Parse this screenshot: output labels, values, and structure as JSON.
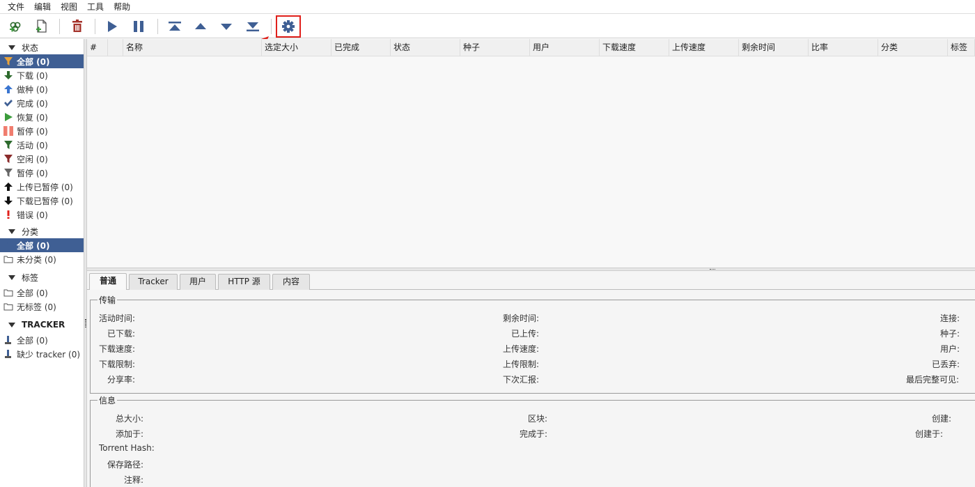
{
  "menu": [
    "文件",
    "编辑",
    "视图",
    "工具",
    "帮助"
  ],
  "toolbar": {
    "buttons": [
      {
        "name": "add-torrent-link-icon"
      },
      {
        "name": "add-torrent-file-icon"
      },
      {
        "name": "delete-icon"
      },
      {
        "name": "resume-icon"
      },
      {
        "name": "pause-icon"
      },
      {
        "name": "move-top-icon"
      },
      {
        "name": "move-up-icon"
      },
      {
        "name": "move-down-icon"
      },
      {
        "name": "move-bottom-icon"
      },
      {
        "name": "options-gear-icon"
      }
    ],
    "highlight_color": "#e0201b"
  },
  "sidebar": {
    "status_header": "状态",
    "status_items": [
      {
        "label": "全部 (0)",
        "icon": "filter-icon"
      },
      {
        "label": "下载 (0)",
        "icon": "download-arrow-icon"
      },
      {
        "label": "做种 (0)",
        "icon": "upload-arrow-icon"
      },
      {
        "label": "完成 (0)",
        "icon": "checkmark-icon"
      },
      {
        "label": "恢复 (0)",
        "icon": "play-icon"
      },
      {
        "label": "暂停 (0)",
        "icon": "pause-icon"
      },
      {
        "label": "活动 (0)",
        "icon": "filter-icon"
      },
      {
        "label": "空闲 (0)",
        "icon": "filter-icon"
      },
      {
        "label": "暂停 (0)",
        "icon": "filter-icon"
      },
      {
        "label": "上传已暂停 (0)",
        "icon": "up-arrow-icon"
      },
      {
        "label": "下载已暂停 (0)",
        "icon": "down-arrow-icon"
      },
      {
        "label": "错误 (0)",
        "icon": "error-icon"
      }
    ],
    "category_header": "分类",
    "category_items": [
      {
        "label": "全部 (0)",
        "icon": "folder-icon"
      },
      {
        "label": "未分类 (0)",
        "icon": "folder-icon"
      }
    ],
    "tag_header": "标签",
    "tag_items": [
      {
        "label": "全部 (0)",
        "icon": "folder-icon"
      },
      {
        "label": "无标签 (0)",
        "icon": "folder-icon"
      }
    ],
    "tracker_header": "TRACKER",
    "tracker_items": [
      {
        "label": "全部 (0)",
        "icon": "tracker-icon"
      },
      {
        "label": "缺少 tracker (0)",
        "icon": "tracker-icon"
      }
    ],
    "selected_color": "#3f5f94"
  },
  "table": {
    "columns": [
      "#",
      "",
      "名称",
      "选定大小",
      "已完成",
      "状态",
      "种子",
      "用户",
      "下载速度",
      "上传速度",
      "剩余时间",
      "比率",
      "分类",
      "标签"
    ]
  },
  "tabs": [
    "普通",
    "Tracker",
    "用户",
    "HTTP 源",
    "内容"
  ],
  "transfer": {
    "title": "传输",
    "col1": [
      "活动时间:",
      "已下载:",
      "下载速度:",
      "下载限制:",
      "分享率:"
    ],
    "col2": [
      "剩余时间:",
      "已上传:",
      "上传速度:",
      "上传限制:",
      "下次汇报:"
    ],
    "col3": [
      "连接:",
      "种子:",
      "用户:",
      "已丢弃:",
      "最后完整可见:"
    ]
  },
  "info": {
    "title": "信息",
    "col1": [
      "总大小:",
      "添加于:",
      "Torrent Hash:",
      "保存路径:",
      "注释:"
    ],
    "col2": [
      "区块:",
      "完成于:"
    ],
    "col3": [
      "创建:",
      "创建于:"
    ]
  }
}
